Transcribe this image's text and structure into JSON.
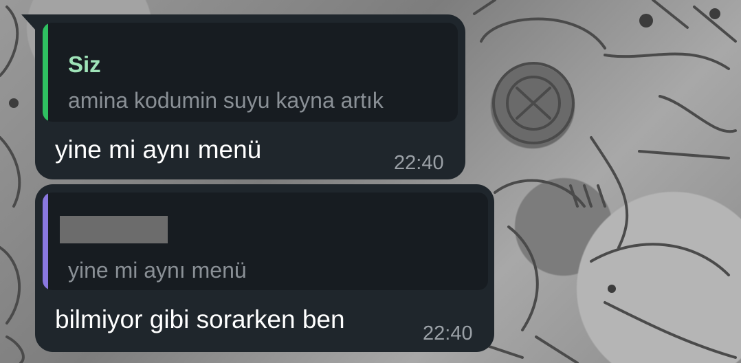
{
  "colors": {
    "bubble_background": "#1f262c",
    "quote_background": "#171c21",
    "quote_bar_self": "#2fc161",
    "quote_bar_other": "#8a78e0",
    "author_self": "#9fe3b8",
    "message_text": "#ffffff",
    "secondary_text": "#8a9096"
  },
  "messages": [
    {
      "reply": {
        "author": "Siz",
        "text": "amina kodumin suyu kayna artık"
      },
      "text": "yine mi aynı menü",
      "time": "22:40"
    },
    {
      "reply": {
        "author": "",
        "author_redacted": true,
        "text": "yine mi aynı menü"
      },
      "text": "bilmiyor gibi sorarken ben",
      "time": "22:40"
    }
  ]
}
